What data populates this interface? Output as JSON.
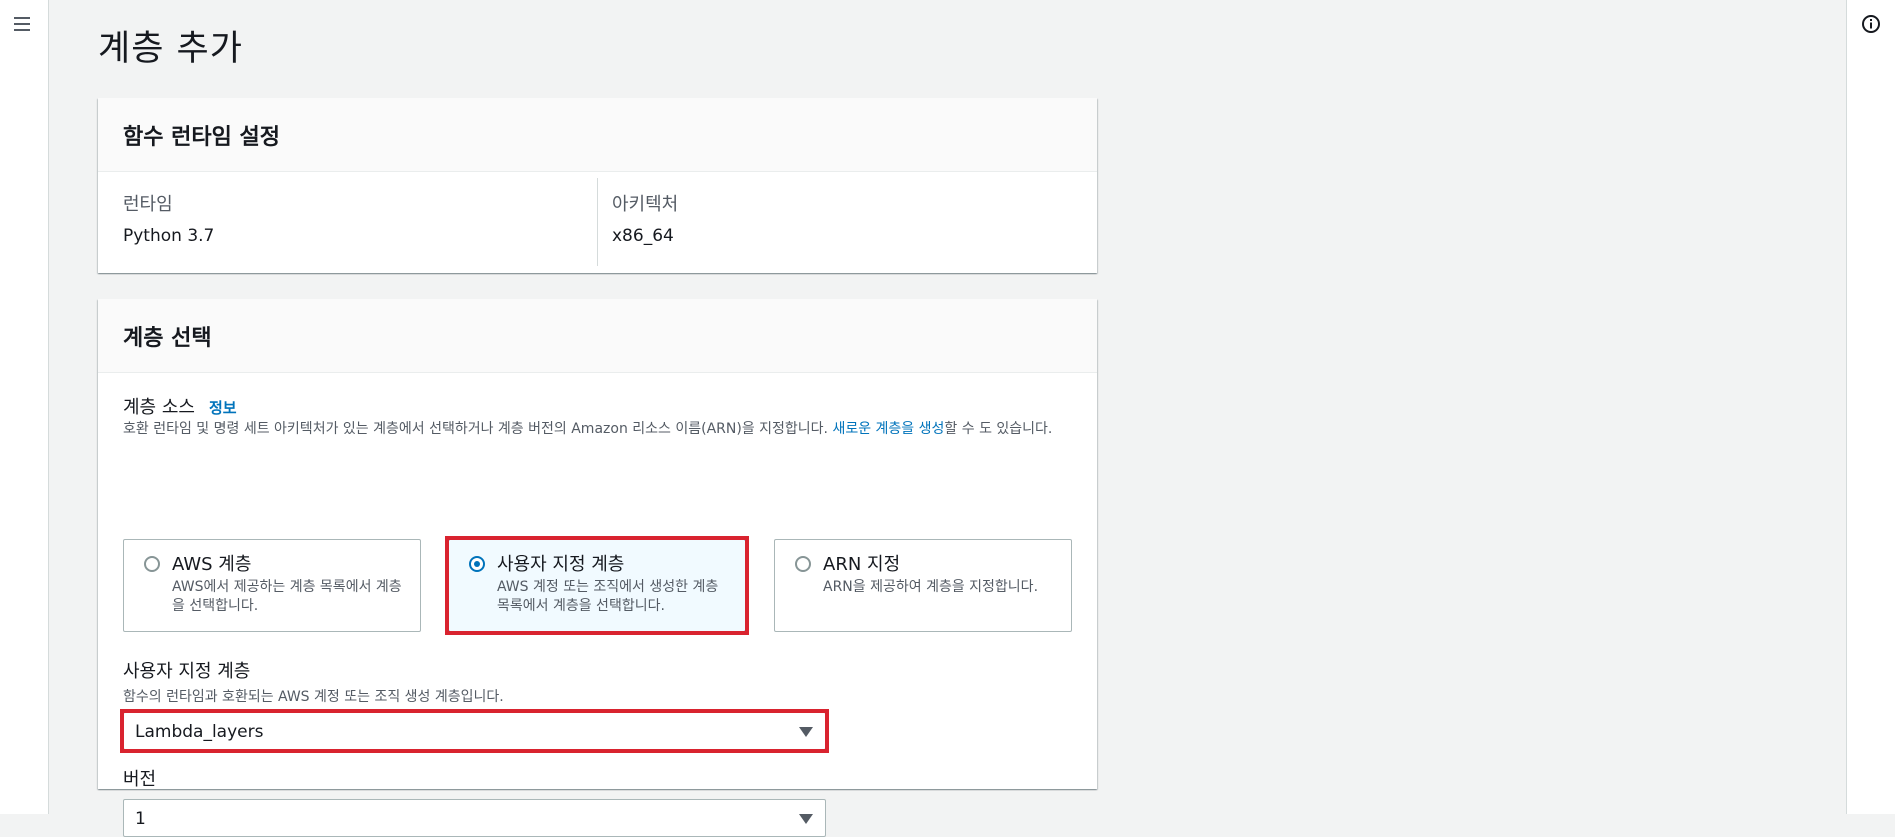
{
  "page": {
    "title": "계층 추가"
  },
  "icons": {
    "menu": "hamburger-menu-icon",
    "info": "info-circle-icon"
  },
  "runtime_section": {
    "header": "함수 런타임 설정",
    "runtime_label": "런타임",
    "runtime_value": "Python 3.7",
    "architecture_label": "아키텍처",
    "architecture_value": "x86_64"
  },
  "layer_section": {
    "header": "계층 선택",
    "source_label": "계층 소스",
    "info_link": "정보",
    "description_prefix": "호환 런타임 및 명령 세트 아키텍처가 있는 계층에서 선택하거나 계층 버전의 Amazon 리소스 이름(ARN)을 지정합니다. ",
    "description_link": "새로운 계층을 생성",
    "description_suffix": "할 수 도 있습니다.",
    "tiles": [
      {
        "title": "AWS 계층",
        "description": "AWS에서 제공하는 계층 목록에서 계층을 선택합니다.",
        "selected": false
      },
      {
        "title": "사용자 지정 계층",
        "description": "AWS 계정 또는 조직에서 생성한 계층 목록에서 계층을 선택합니다.",
        "selected": true
      },
      {
        "title": "ARN 지정",
        "description": "ARN을 제공하여 계층을 지정합니다.",
        "selected": false
      }
    ],
    "custom_layer_label": "사용자 지정 계층",
    "custom_layer_description": "함수의 런타임과 호환되는 AWS 계정 또는 조직 생성 계층입니다.",
    "custom_layer_value": "Lambda_layers",
    "version_label": "버전",
    "version_value": "1"
  },
  "colors": {
    "highlight_outline": "#d9232f",
    "accent": "#0073bb"
  }
}
